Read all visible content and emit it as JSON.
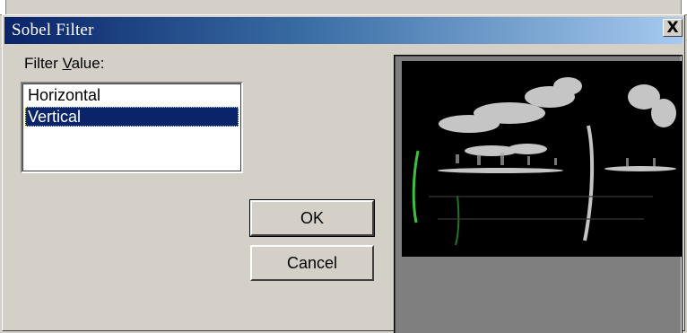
{
  "dialog": {
    "title": "Sobel Filter",
    "close_label": "X"
  },
  "filter": {
    "label_prefix": "Filter ",
    "label_underlined": "V",
    "label_suffix": "alue:",
    "options": [
      {
        "label": "Horizontal",
        "selected": false
      },
      {
        "label": "Vertical",
        "selected": true
      }
    ]
  },
  "buttons": {
    "ok": "OK",
    "cancel": "Cancel"
  },
  "preview": {
    "image": "sobel-vertical-edge-preview"
  },
  "colors": {
    "title_start": "#0a246a",
    "title_end": "#a6caf0",
    "selection": "#0a246a",
    "face": "#d4d0c8"
  }
}
